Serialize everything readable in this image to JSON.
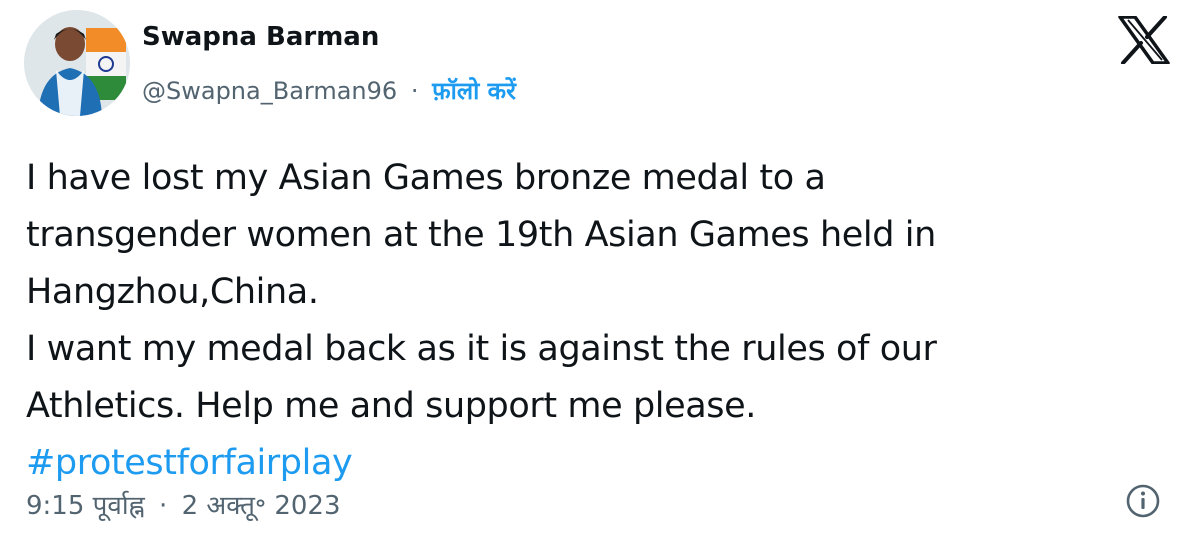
{
  "author": {
    "display_name": "Swapna Barman",
    "handle": "@Swapna_Barman96",
    "separator": "·",
    "follow_label": "फ़ॉलो करें",
    "avatar_icon": "profile-photo"
  },
  "brand": {
    "logo_icon": "x-logo"
  },
  "tweet": {
    "lines": [
      "I have lost my Asian Games bronze medal to a",
      "transgender women at the 19th Asian Games held in",
      "Hangzhou,China.",
      "I want my medal back as it is against the rules of our",
      "Athletics. Help me and support me please."
    ],
    "hashtag": "#protestforfairplay"
  },
  "meta": {
    "time": "9:15 पूर्वाह्न",
    "separator": "·",
    "date": "2 अक्तू॰ 2023",
    "info_icon": "info-icon"
  },
  "colors": {
    "link": "#1d9bf0",
    "text": "#0f1419",
    "secondary": "#536471"
  }
}
